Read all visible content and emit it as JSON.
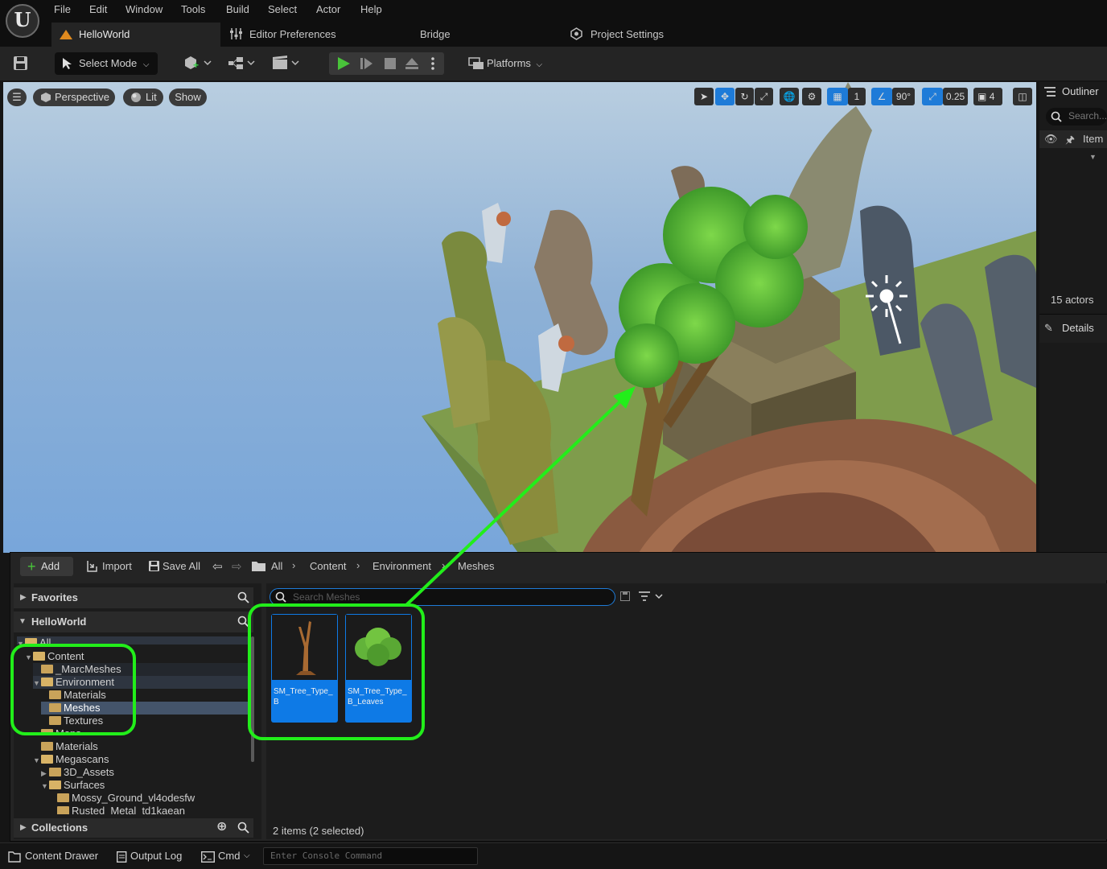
{
  "menu": [
    "File",
    "Edit",
    "Window",
    "Tools",
    "Build",
    "Select",
    "Actor",
    "Help"
  ],
  "tabs": {
    "level": "HelloWorld",
    "editor_prefs": "Editor Preferences",
    "bridge": "Bridge",
    "project_settings": "Project Settings"
  },
  "toolbar": {
    "select_mode": "Select Mode",
    "platforms": "Platforms"
  },
  "viewport": {
    "perspective": "Perspective",
    "lit": "Lit",
    "show": "Show",
    "grid_snap": "1",
    "rot_snap": "90°",
    "scale_snap": "0.25",
    "camera_speed": "4"
  },
  "outliner": {
    "title": "Outliner",
    "search_placeholder": "Search...",
    "item_col": "Item",
    "actor_count": "15 actors",
    "details": "Details"
  },
  "drawer": {
    "add": "Add",
    "import": "Import",
    "save_all": "Save All",
    "breadcrumb": [
      "All",
      "Content",
      "Environment",
      "Meshes"
    ],
    "favorites": "Favorites",
    "project": "HelloWorld",
    "collections": "Collections",
    "search_placeholder": "Search Meshes",
    "tree": [
      "All",
      "Content",
      "_MarcMeshes",
      "Environment",
      "Materials",
      "Meshes",
      "Textures",
      "Maps",
      "Materials",
      "Megascans",
      "3D_Assets",
      "Surfaces",
      "Mossy_Ground_vl4odesfw",
      "Rusted_Metal_td1kaean"
    ],
    "assets": [
      "SM_Tree_Type_B",
      "SM_Tree_Type_B_Leaves"
    ],
    "status": "2 items (2 selected)"
  },
  "statusbar": {
    "content_drawer": "Content Drawer",
    "output_log": "Output Log",
    "cmd": "Cmd",
    "console_placeholder": "Enter Console Command"
  },
  "colors": {
    "highlight": "#22ee1a",
    "selection": "#0e7ae6",
    "accent": "#1e7bd8"
  }
}
